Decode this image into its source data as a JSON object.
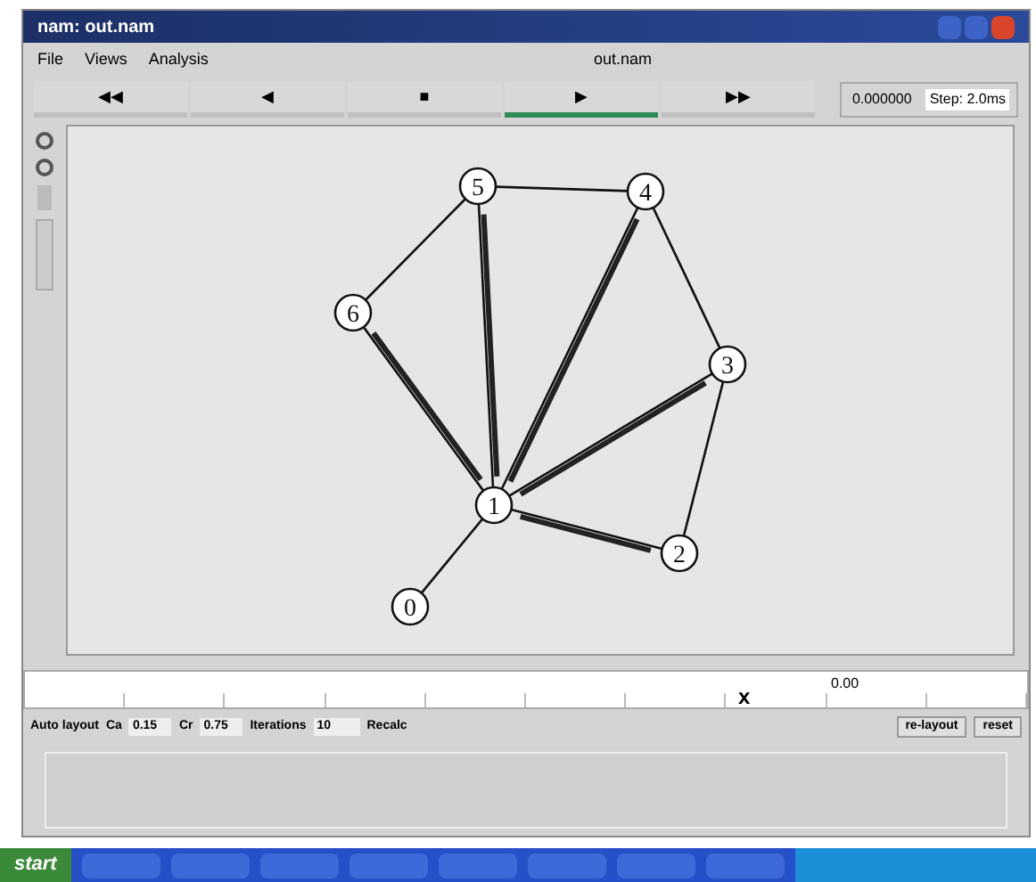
{
  "window": {
    "title": "nam: out.nam"
  },
  "menu": [
    {
      "label": "File"
    },
    {
      "label": "Views"
    },
    {
      "label": "Analysis"
    }
  ],
  "file_name": "out.nam",
  "controls": [
    {
      "glyph": "◀◀",
      "selected": false
    },
    {
      "glyph": "◀",
      "selected": false
    },
    {
      "glyph": "■",
      "selected": false
    },
    {
      "glyph": "▶",
      "selected": true
    },
    {
      "glyph": "▶▶",
      "selected": false
    }
  ],
  "time": "0.000000",
  "step": "Step: 2.0ms",
  "network": {
    "nodes": [
      {
        "label": "0"
      },
      {
        "label": "1"
      },
      {
        "label": "2"
      },
      {
        "label": "3"
      },
      {
        "label": "4"
      },
      {
        "label": "5"
      },
      {
        "label": "6"
      }
    ],
    "links": [
      {
        "busy": false
      },
      {
        "busy": true
      },
      {
        "busy": true
      },
      {
        "busy": true
      },
      {
        "busy": true
      },
      {
        "busy": true
      },
      {
        "busy": false
      },
      {
        "busy": false
      },
      {
        "busy": false
      },
      {
        "busy": false
      }
    ]
  },
  "timeline": {
    "marker": "x",
    "label": "0.00"
  },
  "layout_bar": {
    "title": "Auto layout",
    "ca_label": "Ca",
    "ca": "0.15",
    "cr_label": "Cr",
    "cr": "0.75",
    "iter_label": "Iterations",
    "iterations": "10",
    "recalc": "Recalc",
    "relayout": "re-layout",
    "reset": "reset"
  },
  "taskbar": {
    "start": "start"
  }
}
